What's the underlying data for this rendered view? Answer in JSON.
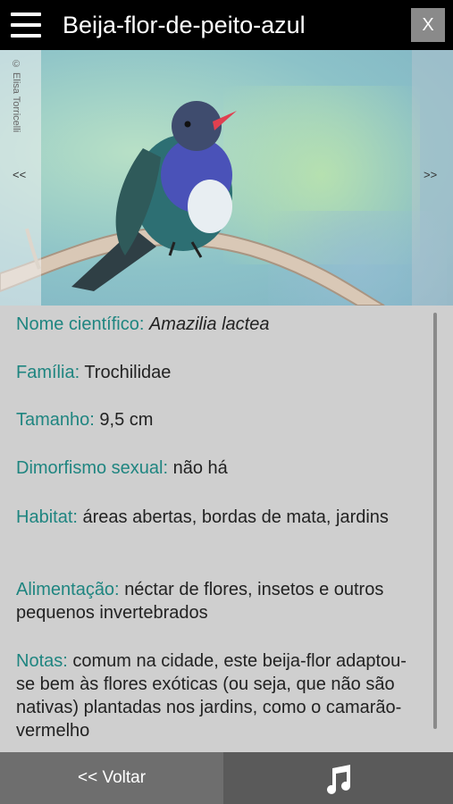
{
  "header": {
    "title": "Beija-flor-de-peito-azul",
    "close_label": "X"
  },
  "photo": {
    "credit": "© Elisa Torricelli",
    "prev_label": "<<",
    "next_label": ">>"
  },
  "info": {
    "entries": [
      {
        "label": "Nome científico:",
        "value": "Amazilia lactea"
      },
      {
        "label": "Família:",
        "value": "Trochilidae"
      },
      {
        "label": "Tamanho:",
        "value": "9,5 cm"
      },
      {
        "label": "Dimorfismo sexual:",
        "value": "não há"
      },
      {
        "label": "Habitat:",
        "value": "áreas abertas, bordas de mata, jardins"
      },
      {
        "label": "Alimentação:",
        "value": "néctar de flores, insetos e outros pequenos invertebrados"
      },
      {
        "label": "Notas:",
        "value": "comum na cidade, este beija-flor adaptou-se bem às flores exóticas (ou seja, que não são nativas) plantadas nos jardins, como o camarão-vermelho"
      }
    ]
  },
  "footer": {
    "back_label": "<< Voltar",
    "music_icon": "music-note-icon"
  },
  "colors": {
    "label": "#1f8580",
    "topbar": "#000000",
    "footer": "#5a5a5a"
  }
}
